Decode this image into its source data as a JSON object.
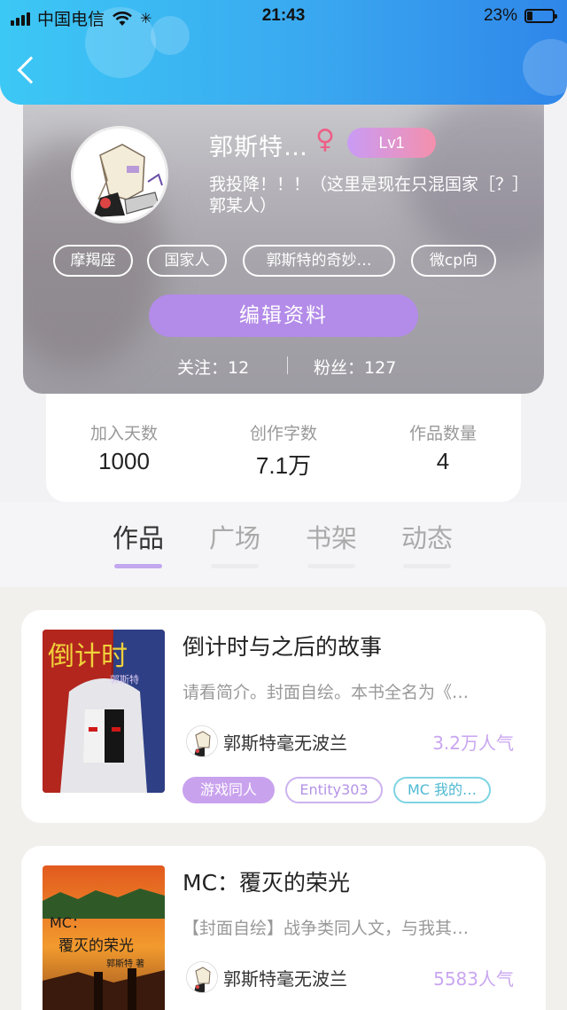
{
  "status_bar": {
    "carrier": "中国电信",
    "time": "21:43",
    "battery": "23%",
    "battery_level": 0.23
  },
  "profile": {
    "name": "郭斯特…",
    "gender_symbol": "♀",
    "level": "Lv1",
    "bio_line1": "我投降！！！（这里是现在只混国家［？］",
    "bio_line2": "郭某人）",
    "tags": [
      "摩羯座",
      "国家人",
      "郭斯特的奇妙…",
      "微cp向"
    ],
    "edit_label": "编辑资料",
    "following_label": "关注：",
    "following_count": "12",
    "followers_label": "粉丝：",
    "followers_count": "127"
  },
  "stats": [
    {
      "label": "加入天数",
      "value": "1000"
    },
    {
      "label": "创作字数",
      "value": "7.1万"
    },
    {
      "label": "作品数量",
      "value": "4"
    }
  ],
  "tabs": [
    {
      "label": "作品",
      "active": true
    },
    {
      "label": "广场",
      "active": false
    },
    {
      "label": "书架",
      "active": false
    },
    {
      "label": "动态",
      "active": false
    }
  ],
  "books": [
    {
      "title": "倒计时与之后的故事",
      "desc": "请看简介。封面自绘。本书全名为《…",
      "author": "郭斯特毫无波兰",
      "popularity": "3.2万人气",
      "cover_text_1": "倒计时",
      "cover_text_2": "郭斯特",
      "tags": [
        "游戏同人",
        "Entity303",
        "MC 我的…"
      ]
    },
    {
      "title": "MC：覆灭的荣光",
      "desc": "【封面自绘】战争类同人文，与我其…",
      "author": "郭斯特毫无波兰",
      "popularity": "5583人气",
      "cover_text_1": "MC：",
      "cover_text_2": "覆灭的荣光",
      "cover_text_3": "郭斯特 著"
    }
  ],
  "colors": {
    "header_start": "#3cc8f5",
    "header_end": "#2f86e9",
    "accent_purple": "#b38be8",
    "popularity": "#c9a6f0"
  }
}
